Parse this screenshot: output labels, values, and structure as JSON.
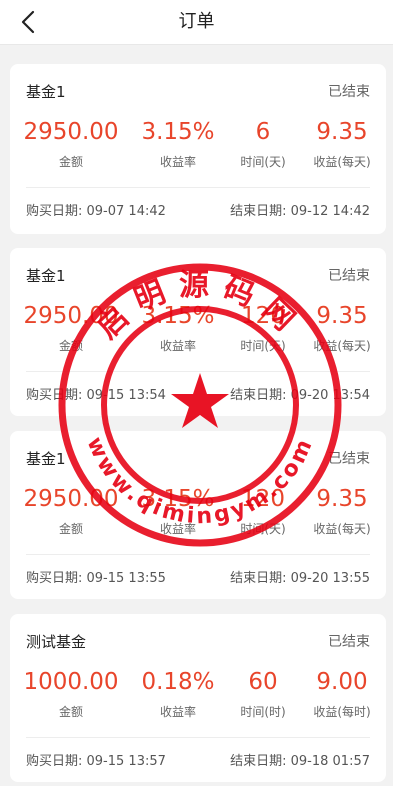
{
  "header": {
    "title": "订单",
    "back_icon": "chevron-left-icon"
  },
  "labels": {
    "amount": "金额",
    "yield_rate": "收益率"
  },
  "orders": [
    {
      "name": "基金1",
      "status": "已结束",
      "amount": "2950.00",
      "rate": "3.15%",
      "duration": "6",
      "duration_label": "时间(天)",
      "income": "9.35",
      "income_label": "收益(每天)",
      "buy_date": "购买日期: 09-07 14:42",
      "end_date": "结束日期: 09-12 14:42"
    },
    {
      "name": "基金1",
      "status": "已结束",
      "amount": "2950.00",
      "rate": "3.15%",
      "duration": "120",
      "duration_label": "时间(天)",
      "income": "9.35",
      "income_label": "收益(每天)",
      "buy_date": "购买日期: 09-15 13:54",
      "end_date": "结束日期: 09-20 13:54"
    },
    {
      "name": "基金1",
      "status": "已结束",
      "amount": "2950.00",
      "rate": "3.15%",
      "duration": "120",
      "duration_label": "时间(天)",
      "income": "9.35",
      "income_label": "收益(每天)",
      "buy_date": "购买日期: 09-15 13:55",
      "end_date": "结束日期: 09-20 13:55"
    },
    {
      "name": "测试基金",
      "status": "已结束",
      "amount": "1000.00",
      "rate": "0.18%",
      "duration": "60",
      "duration_label": "时间(时)",
      "income": "9.00",
      "income_label": "收益(每时)",
      "buy_date": "购买日期: 09-15 13:57",
      "end_date": "结束日期: 09-18 01:57"
    }
  ],
  "watermark": {
    "top_text": "启明源码网",
    "bottom_text": "www.qimingym.com",
    "color": "#e60012"
  },
  "colors": {
    "accent": "#e8452b",
    "muted": "#666666",
    "background": "#f2f2f2"
  }
}
